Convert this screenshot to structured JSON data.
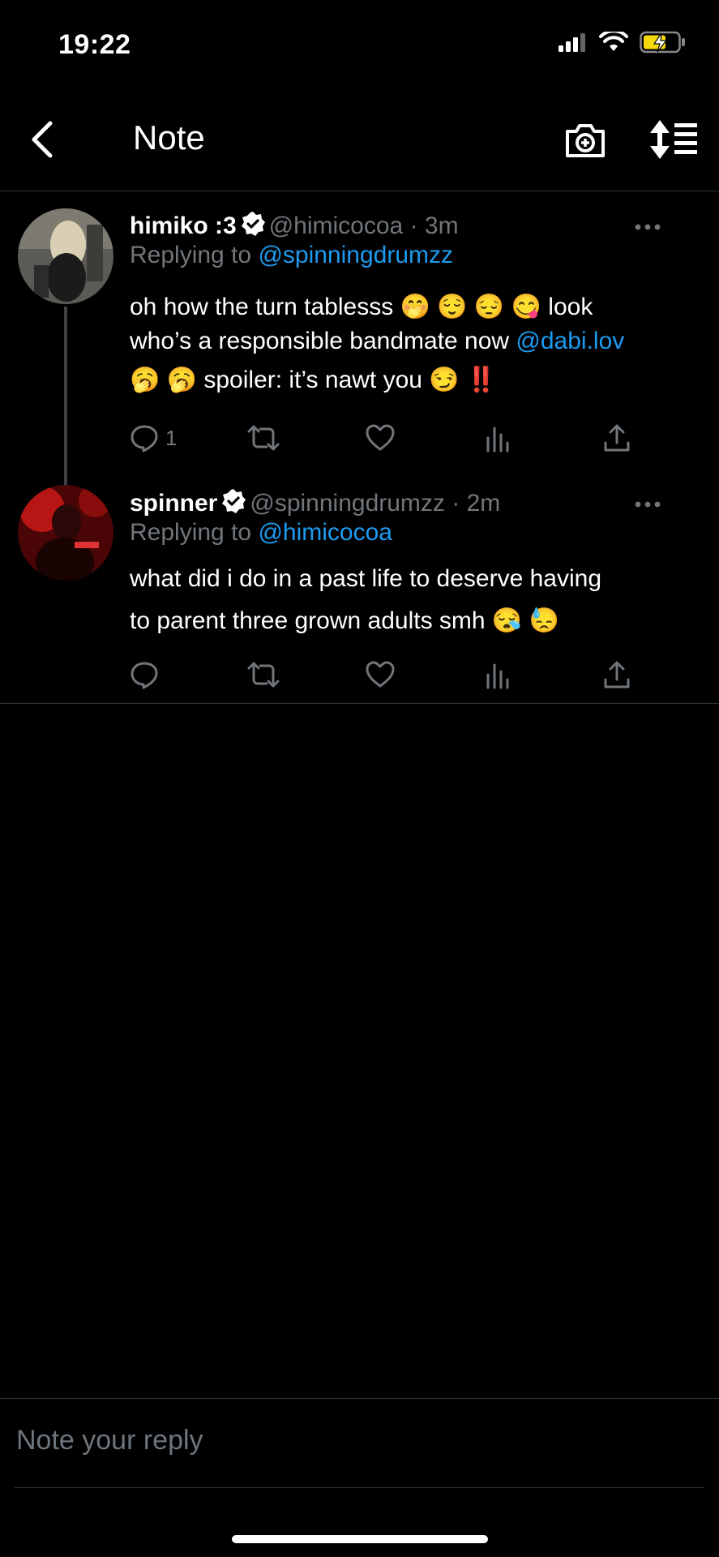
{
  "status_bar": {
    "time": "19:22"
  },
  "nav": {
    "title": "Note"
  },
  "tweets": [
    {
      "name": "himiko :3",
      "handle": "@himicocoa",
      "time": "· 3m",
      "replying_prefix": "Replying to",
      "replying_to": "@spinningdrumzz",
      "body_line1": "oh how the turn tablesss 🤭 😌 😔 😋  look",
      "body_line2_pre": "who’s a responsible bandmate now ",
      "body_line2_mention": "@dabi.lov",
      "body_line3_pre": "🥱 🥱 spoiler: it’s nawt you 😏 ",
      "body_line3_bang": "‼️",
      "reply_count": "1"
    },
    {
      "name": "spinner",
      "handle": "@spinningdrumzz",
      "time": "· 2m",
      "replying_prefix": "Replying to",
      "replying_to": "@himicocoa",
      "body_line1": "what did i do in a past life to deserve having",
      "body_line2": "to parent three grown adults smh 😪 😓",
      "reply_count": ""
    }
  ],
  "reply": {
    "placeholder": "Note your reply"
  },
  "colors": {
    "accent": "#1d9bf0",
    "muted": "#71767b",
    "background": "#000000"
  }
}
